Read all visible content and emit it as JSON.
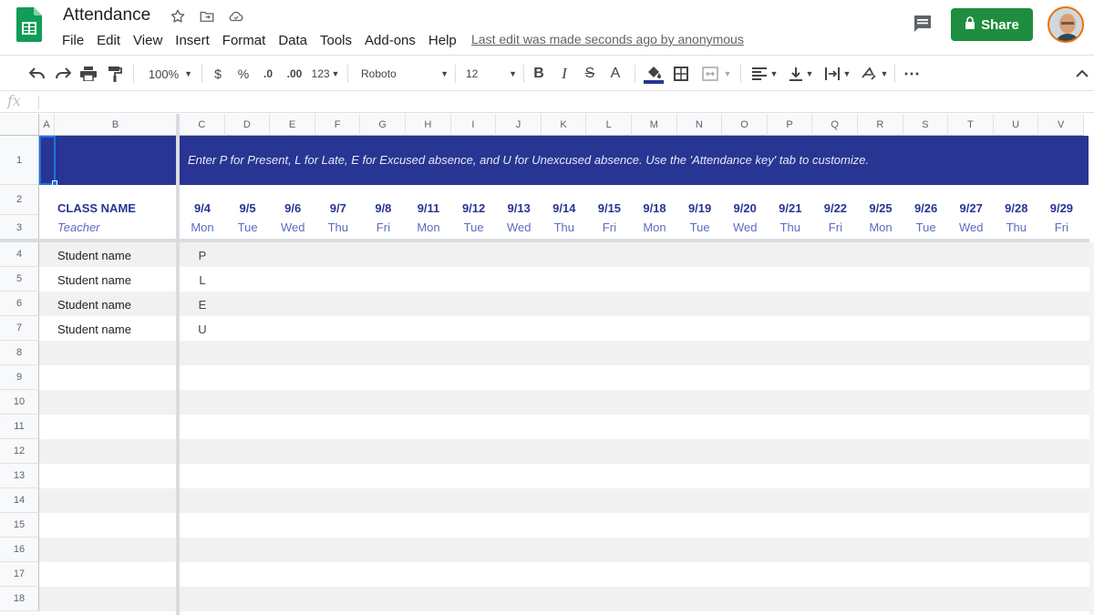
{
  "doc": {
    "title": "Attendance",
    "last_edit": "Last edit was made seconds ago by anonymous",
    "share_label": "Share"
  },
  "menu": [
    "File",
    "Edit",
    "View",
    "Insert",
    "Format",
    "Data",
    "Tools",
    "Add-ons",
    "Help"
  ],
  "toolbar": {
    "zoom": "100%",
    "currency": "$",
    "percent": "%",
    "decrease_decimal": ".0",
    "increase_decimal": ".00",
    "more_formats": "123",
    "font": "Roboto",
    "font_size": "12",
    "bold": "B",
    "italic": "I",
    "strike": "S",
    "text_color": "A",
    "more": "⋯"
  },
  "formula_bar": {
    "fx": "fx"
  },
  "columns": [
    "A",
    "B",
    "C",
    "D",
    "E",
    "F",
    "G",
    "H",
    "I",
    "J",
    "K",
    "L",
    "M",
    "N",
    "O",
    "P",
    "Q",
    "R",
    "S",
    "T",
    "U",
    "V"
  ],
  "rows": [
    "1",
    "2",
    "3",
    "4",
    "5",
    "6",
    "7",
    "8",
    "9",
    "10",
    "11",
    "12",
    "13",
    "14",
    "15",
    "16",
    "17",
    "18"
  ],
  "sheet": {
    "instructions": "Enter P for Present, L for Late, E for Excused absence, and U for Unexcused absence. Use the 'Attendance key' tab to customize.",
    "class_name": "CLASS NAME",
    "teacher": "Teacher",
    "dates": [
      "9/4",
      "9/5",
      "9/6",
      "9/7",
      "9/8",
      "9/11",
      "9/12",
      "9/13",
      "9/14",
      "9/15",
      "9/18",
      "9/19",
      "9/20",
      "9/21",
      "9/22",
      "9/25",
      "9/26",
      "9/27",
      "9/28",
      "9/29"
    ],
    "days": [
      "Mon",
      "Tue",
      "Wed",
      "Thu",
      "Fri",
      "Mon",
      "Tue",
      "Wed",
      "Thu",
      "Fri",
      "Mon",
      "Tue",
      "Wed",
      "Thu",
      "Fri",
      "Mon",
      "Tue",
      "Wed",
      "Thu",
      "Fri"
    ],
    "students": [
      {
        "name": "Student name",
        "code": "P"
      },
      {
        "name": "Student name",
        "code": "L"
      },
      {
        "name": "Student name",
        "code": "E"
      },
      {
        "name": "Student name",
        "code": "U"
      }
    ]
  },
  "colors": {
    "banner": "#283593",
    "header_text": "#283593",
    "share_green": "#1e8e3e",
    "selection": "#1a73e8"
  }
}
